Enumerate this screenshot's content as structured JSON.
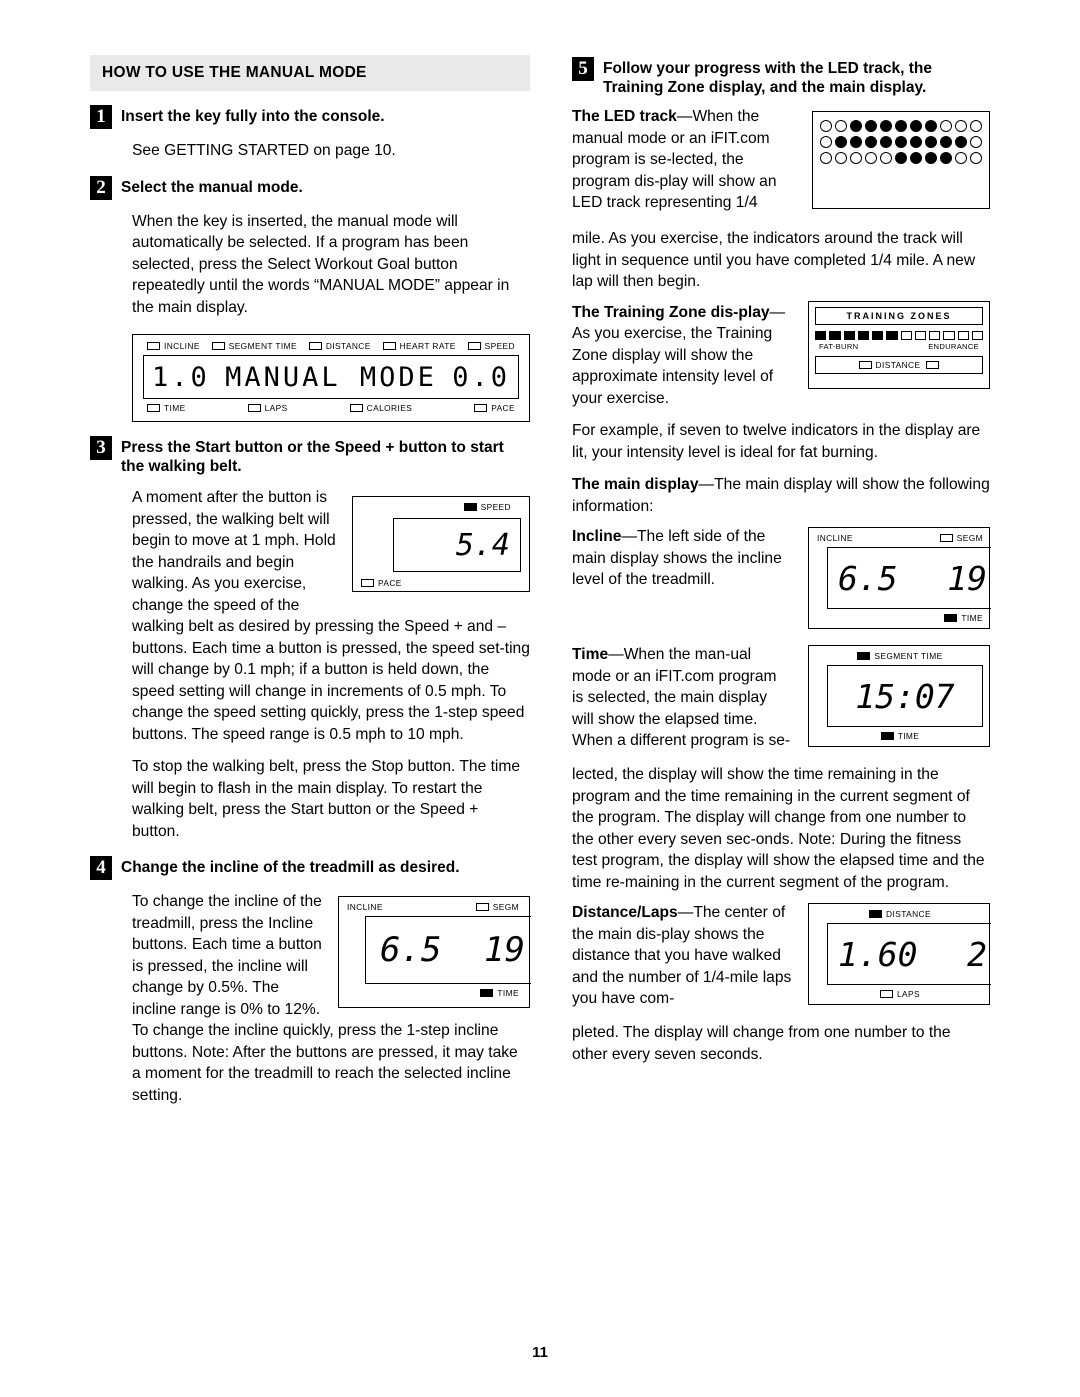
{
  "page_number": "11",
  "left": {
    "section_title": "HOW TO USE THE MANUAL MODE",
    "step1": {
      "num": "1",
      "heading": "Insert the key fully into the console.",
      "body": "See GETTING STARTED on page 10."
    },
    "step2": {
      "num": "2",
      "heading": "Select the manual mode.",
      "body": "When the key is inserted, the manual mode will automatically be selected. If a program has been selected, press the Select Workout Goal button repeatedly until the words “MANUAL MODE” appear in the main display."
    },
    "main_display": {
      "labels_top": [
        "INCLINE",
        "SEGMENT TIME",
        "DISTANCE",
        "HEART RATE",
        "SPEED"
      ],
      "labels_bottom": [
        "TIME",
        "LAPS",
        "CALORIES",
        "PACE"
      ],
      "left_value": "1.0",
      "center_value": "MANUAL MODE",
      "right_value": "0.0"
    },
    "step3": {
      "num": "3",
      "heading": "Press the Start button or the Speed + button to start the walking belt.",
      "p1": "A moment after the button is pressed, the walking belt will begin to move at 1 mph. Hold the handrails and begin walking. As you exercise, change the speed of the walking belt as desired by pressing the Speed + and – buttons. Each time a button is pressed, the speed set-ting will change by 0.1 mph; if a button is held down, the speed setting will change in increments of 0.5 mph. To change the speed setting quickly, press the 1-step speed buttons. The speed range is 0.5 mph to 10 mph.",
      "p2": "To stop the walking belt, press the Stop button. The time will begin to flash in the main display. To restart the walking belt, press the Start button or the Speed + button."
    },
    "speed_panel": {
      "label_top": "SPEED",
      "label_bottom": "PACE",
      "value": "5.4"
    },
    "step4": {
      "num": "4",
      "heading": "Change the incline of the treadmill as desired.",
      "body": "To change the incline of the treadmill, press the Incline buttons. Each time a button is pressed, the incline will change by 0.5%. The incline range is 0% to 12%. To change the incline quickly, press the 1-step incline buttons. Note: After the buttons are pressed, it may take a moment for the treadmill to reach the selected incline setting."
    },
    "incline_panel": {
      "label_left": "INCLINE",
      "label_right": "SEGM",
      "label_bottom": "TIME",
      "value_left": "6.5",
      "value_right": "19"
    }
  },
  "right": {
    "step5": {
      "num": "5",
      "heading": "Follow your progress with the LED track, the Training Zone display, and the main display."
    },
    "led": {
      "lead": "The LED track",
      "dash": "—",
      "text1": "When the manual mode or an iFIT.com program is se-lected, the program dis-play will show an LED track representing 1/4",
      "text2": "mile. As you exercise, the indicators around the track will light in sequence until you have completed 1/4 mile. A new lap will then begin."
    },
    "training_zone": {
      "lead": "The Training Zone dis-play",
      "dash": "—",
      "text1": "As you exercise, the Training Zone display will show the approximate intensity level of your exercise.",
      "text2": "For example, if seven to twelve indicators in the display are lit, your intensity level is ideal for fat burning.",
      "panel_title": "TRAINING ZONES",
      "label_left": "FAT-BURN",
      "label_right": "ENDURANCE",
      "label_distance": "DISTANCE",
      "bars_lit": 6,
      "bars_total": 12
    },
    "main_display_text": {
      "lead": "The main display",
      "dash": "—",
      "text": "The main display will show the following information:"
    },
    "incline": {
      "lead": "Incline",
      "dash": "—",
      "text": "The left side of the main display shows the incline level of the treadmill.",
      "panel": {
        "label_left": "INCLINE",
        "label_right": "SEGM",
        "label_bottom": "TIME",
        "value_left": "6.5",
        "value_right": "19"
      }
    },
    "time": {
      "lead": "Time",
      "dash": "—",
      "text1": "When the man-ual mode or an iFIT.com program is selected, the main display will show the elapsed time. When a different program is se-",
      "text2": "lected, the display will show the time remaining in the program and the time remaining in the current segment of the program. The display will change from one number to the other every seven sec-onds. Note: During the fitness test program, the display will show the elapsed time and the time re-maining in the current segment of the program.",
      "panel": {
        "label_top": "SEGMENT TIME",
        "label_bottom": "TIME",
        "value": "15:07"
      }
    },
    "distance": {
      "lead": "Distance/Laps",
      "dash": "—",
      "text1": "The center of the main dis-play shows the distance that you have walked and the number of 1/4-mile laps you have com-",
      "text2": "pleted. The display will change from one number to the other every seven seconds.",
      "panel": {
        "label_top": "DISTANCE",
        "label_bottom": "LAPS",
        "value": "1.60",
        "value_right": "2"
      }
    }
  }
}
